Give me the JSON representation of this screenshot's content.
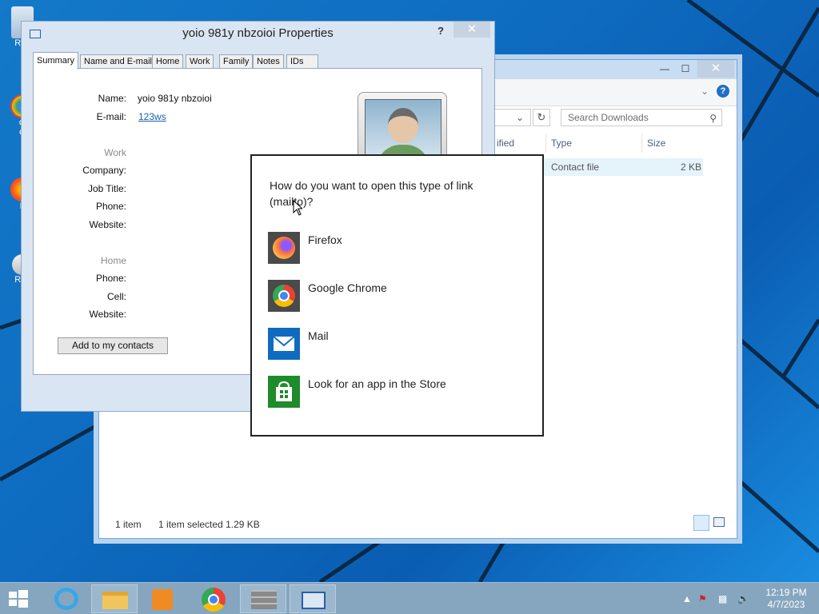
{
  "desktop": {
    "icons": [
      {
        "name": "recycle-bin",
        "label": "Rec"
      },
      {
        "name": "google-chrome-shortcut",
        "label": "G\nC"
      },
      {
        "name": "firefox-shortcut",
        "label": "F"
      },
      {
        "name": "recorder-shortcut",
        "label": "Rec"
      }
    ]
  },
  "explorer": {
    "search_placeholder": "Search Downloads",
    "columns": {
      "modified": "ified",
      "type": "Type",
      "size": "Size"
    },
    "row": {
      "type": "Contact file",
      "size": "2 KB"
    },
    "status": {
      "count": "1 item",
      "selected": "1 item selected  1.29 KB"
    }
  },
  "properties": {
    "title": "yoio 981y nbzoioi Properties",
    "help": "?",
    "tabs": [
      "Summary",
      "Name and E-mail",
      "Home",
      "Work",
      "Family",
      "Notes",
      "IDs"
    ],
    "fields": {
      "name_label": "Name:",
      "name_value": "yoio 981y nbzoioi",
      "email_label": "E-mail:",
      "email_value": "123ws",
      "work_group": "Work",
      "company_label": "Company:",
      "jobtitle_label": "Job Title:",
      "phone_label": "Phone:",
      "website_label": "Website:",
      "home_group": "Home",
      "home_phone_label": "Phone:",
      "cell_label": "Cell:",
      "home_website_label": "Website:"
    },
    "add_button": "Add to my contacts"
  },
  "chooser": {
    "question": "How do you want to open this type of link (mailto)?",
    "options": [
      {
        "label": "Firefox",
        "icon": "firefox-icon"
      },
      {
        "label": "Google Chrome",
        "icon": "chrome-icon"
      },
      {
        "label": "Mail",
        "icon": "mail-icon"
      },
      {
        "label": "Look for an app in the Store",
        "icon": "store-icon"
      }
    ]
  },
  "taskbar": {
    "time": "12:19 PM",
    "date": "4/7/2023"
  }
}
